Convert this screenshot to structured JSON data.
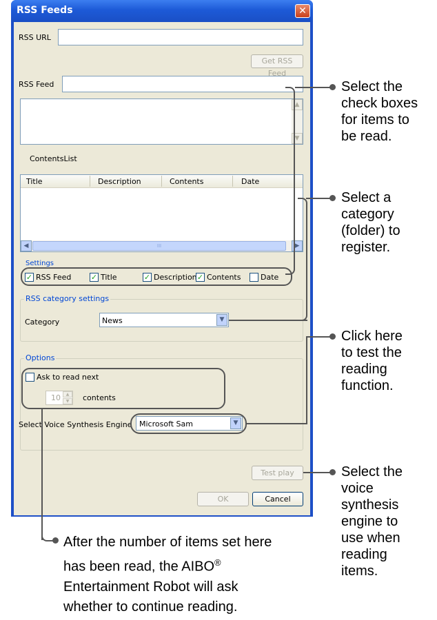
{
  "window": {
    "title": "RSS Feeds",
    "close_glyph": "✕"
  },
  "rss_url": {
    "label": "RSS URL",
    "value": ""
  },
  "get_feed_button": "Get RSS Feed",
  "rss_feed": {
    "label": "RSS Feed",
    "value": ""
  },
  "contents_list": {
    "label": "ContentsList",
    "columns": [
      "Title",
      "Description",
      "Contents",
      "Date"
    ],
    "rows": [],
    "scroll_thumb_grip": "III"
  },
  "settings": {
    "title": "Settings",
    "checkboxes": [
      {
        "label": "RSS Feed",
        "checked": true
      },
      {
        "label": "Title",
        "checked": true
      },
      {
        "label": "Description",
        "checked": true
      },
      {
        "label": "Contents",
        "checked": true
      },
      {
        "label": "Date",
        "checked": false
      }
    ]
  },
  "category_settings": {
    "title": "RSS category settings",
    "label": "Category",
    "selected": "News"
  },
  "options": {
    "title": "Options",
    "ask_label": "Ask to read next",
    "ask_checked": false,
    "count": "10",
    "count_suffix": "contents",
    "engine_label": "Select Voice Synthesis Engine",
    "engine_selected": "Microsoft Sam"
  },
  "test_play_button": "Test play",
  "ok_button": "OK",
  "cancel_button": "Cancel",
  "callouts": {
    "checkboxes": [
      "Select the",
      "check boxes",
      "for items to",
      "be read."
    ],
    "category": [
      "Select a",
      "category",
      "(folder) to",
      "register."
    ],
    "test": [
      "Click here",
      "to test the",
      "reading",
      "function."
    ],
    "engine": [
      "Select the",
      "voice",
      "synthesis",
      "engine to",
      "use when",
      "reading",
      "items."
    ],
    "ask_line1": "After the number of items set here",
    "ask_line2_prefix": "has been read, the AIBO",
    "ask_line2_sup": "®",
    "ask_line3": "Entertainment Robot will ask",
    "ask_line4": "whether to continue reading."
  }
}
